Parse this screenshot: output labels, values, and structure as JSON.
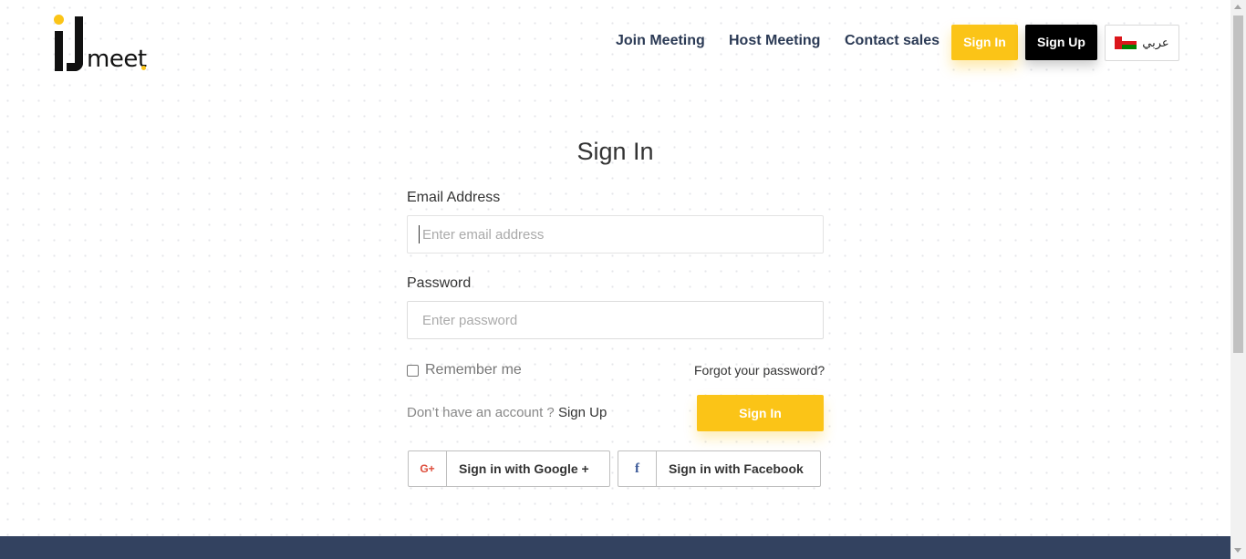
{
  "header": {
    "logo_text": "meet",
    "nav": {
      "join_meeting": "Join Meeting",
      "host_meeting": "Host Meeting",
      "contact_sales": "Contact sales"
    },
    "sign_in_label": "Sign In",
    "sign_up_label": "Sign Up",
    "language_label": "عربي",
    "language_flag": "oman-flag-icon"
  },
  "form": {
    "title": "Sign In",
    "email_label": "Email Address",
    "email_placeholder": "Enter email address",
    "email_value": "",
    "password_label": "Password",
    "password_placeholder": "Enter password",
    "password_value": "",
    "remember_label": "Remember me",
    "remember_checked": false,
    "forgot_label": "Forgot your password?",
    "no_account_text": "Don’t have an account ?",
    "sign_up_link": "Sign Up",
    "submit_label": "Sign In",
    "google_icon_text": "G+",
    "google_label": "Sign in with Google +",
    "facebook_icon_text": "f",
    "facebook_label": "Sign in with Facebook"
  },
  "colors": {
    "accent": "#fbc417",
    "nav_text": "#2b3a55",
    "footer": "#334260"
  }
}
